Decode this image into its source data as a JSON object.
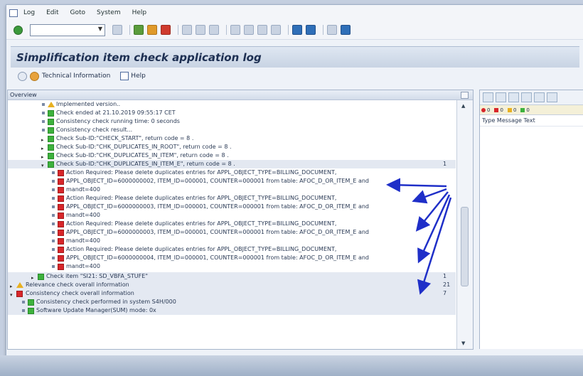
{
  "menu": [
    "Log",
    "Edit",
    "Goto",
    "System",
    "Help"
  ],
  "toolbar": {
    "command_field_value": ""
  },
  "page": {
    "title": "Simplification item check application log"
  },
  "app_toolbar": {
    "technical_info": "Technical Information",
    "help": "Help"
  },
  "overview": {
    "header": "Overview",
    "rows": [
      {
        "label": "Implemented version..",
        "icon": "warning"
      },
      {
        "label": "Check ended at 21.10.2019 09:55:17 CET",
        "icon": "green"
      },
      {
        "label": "Consistency check running time: 0  seconds",
        "icon": "green"
      },
      {
        "label": "Consistency check result...",
        "icon": "green"
      },
      {
        "label": "Check Sub-ID:\"CHECK_START\", return code = 8 .",
        "icon": "green"
      },
      {
        "label": "Check Sub-ID:\"CHK_DUPLICATES_IN_ROOT\", return code = 8 .",
        "icon": "green"
      },
      {
        "label": "Check Sub-ID:\"CHK_DUPLICATES_IN_ITEM\", return code = 8 .",
        "icon": "green"
      },
      {
        "label": "Check Sub-ID:\"CHK_DUPLICATES_IN_ITEM_E\", return code = 8 .",
        "icon": "green"
      },
      {
        "label": "Action Required: Please delete duplicates entries for APPL_OBJECT_TYPE=BILLING_DOCUMENT,",
        "icon": "red"
      },
      {
        "label": "APPL_OBJECT_ID=6000000002, ITEM_ID=000001, COUNTER=000001 from table: AFOC_D_OR_ITEM_E and",
        "icon": "red"
      },
      {
        "label": "mandt=400",
        "icon": "red"
      },
      {
        "label": "Action Required: Please delete duplicates entries for APPL_OBJECT_TYPE=BILLING_DOCUMENT,",
        "icon": "red"
      },
      {
        "label": "APPL_OBJECT_ID=6000000003, ITEM_ID=000001, COUNTER=000001 from table: AFOC_D_OR_ITEM_E and",
        "icon": "red"
      },
      {
        "label": "mandt=400",
        "icon": "red"
      },
      {
        "label": "Action Required: Please delete duplicates entries for APPL_OBJECT_TYPE=BILLING_DOCUMENT,",
        "icon": "red"
      },
      {
        "label": "APPL_OBJECT_ID=6000000003, ITEM_ID=000001, COUNTER=000001 from table: AFOC_D_OR_ITEM_E and",
        "icon": "red"
      },
      {
        "label": "mandt=400",
        "icon": "red"
      },
      {
        "label": "Action Required: Please delete duplicates entries for APPL_OBJECT_TYPE=BILLING_DOCUMENT,",
        "icon": "red"
      },
      {
        "label": "APPL_OBJECT_ID=6000000004, ITEM_ID=000001, COUNTER=000001 from table: AFOC_D_OR_ITEM_E and",
        "icon": "red"
      },
      {
        "label": "mandt=400",
        "icon": "red"
      },
      {
        "label": "Check item \"SI21: SD_VBFA_STUFE\"",
        "icon": "green"
      },
      {
        "label": "Relevance check overall information",
        "icon": "warning"
      },
      {
        "label": "Consistency check overall information",
        "icon": "red"
      },
      {
        "label": "Consistency check performed in system S4H/000",
        "icon": "green"
      },
      {
        "label": "Software Update Manager(SUM) mode: 0x",
        "icon": "green"
      }
    ],
    "counts": {
      "row7": "1",
      "row20": "1",
      "row21": "21",
      "row22": "7"
    }
  },
  "right_panel": {
    "filter": [
      "0",
      "0",
      "0",
      "0"
    ],
    "header": "Type Message Text"
  }
}
